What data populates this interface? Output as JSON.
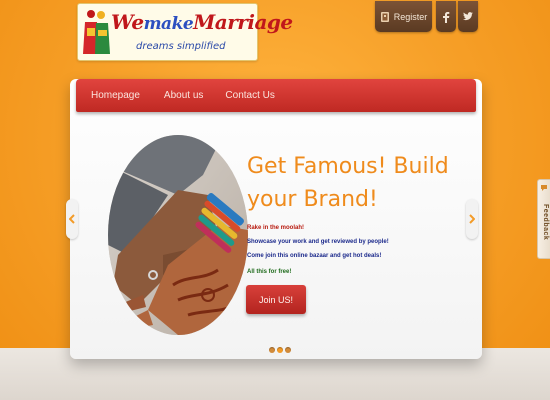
{
  "logo": {
    "title_part1": "We",
    "title_part2": "make",
    "title_part3": "Marriage",
    "tagline": "dreams simplified"
  },
  "topbar": {
    "register_label": "Register",
    "facebook_icon": "facebook-icon",
    "twitter_icon": "twitter-icon"
  },
  "nav": {
    "items": [
      {
        "label": "Homepage"
      },
      {
        "label": "About us"
      },
      {
        "label": "Contact Us"
      }
    ]
  },
  "slide": {
    "headline": "Get Famous! Build your Brand!",
    "line1": "Rake in the moolah!",
    "line2": "Showcase your work and get reviewed by people!",
    "line3": "Come join this online bazaar and get hot deals!",
    "line4": "All this for free!",
    "cta_label": "Join US!",
    "image": "couple-hands-henna-photo"
  },
  "slider": {
    "dots": 3,
    "active_dot": 2
  },
  "feedback": {
    "label": "Feedback"
  },
  "colors": {
    "background": "#f49a1f",
    "nav": "#d2362f",
    "headline": "#ef8b1c",
    "cta": "#c8302a",
    "topbar_buttons": "#6b462c"
  }
}
